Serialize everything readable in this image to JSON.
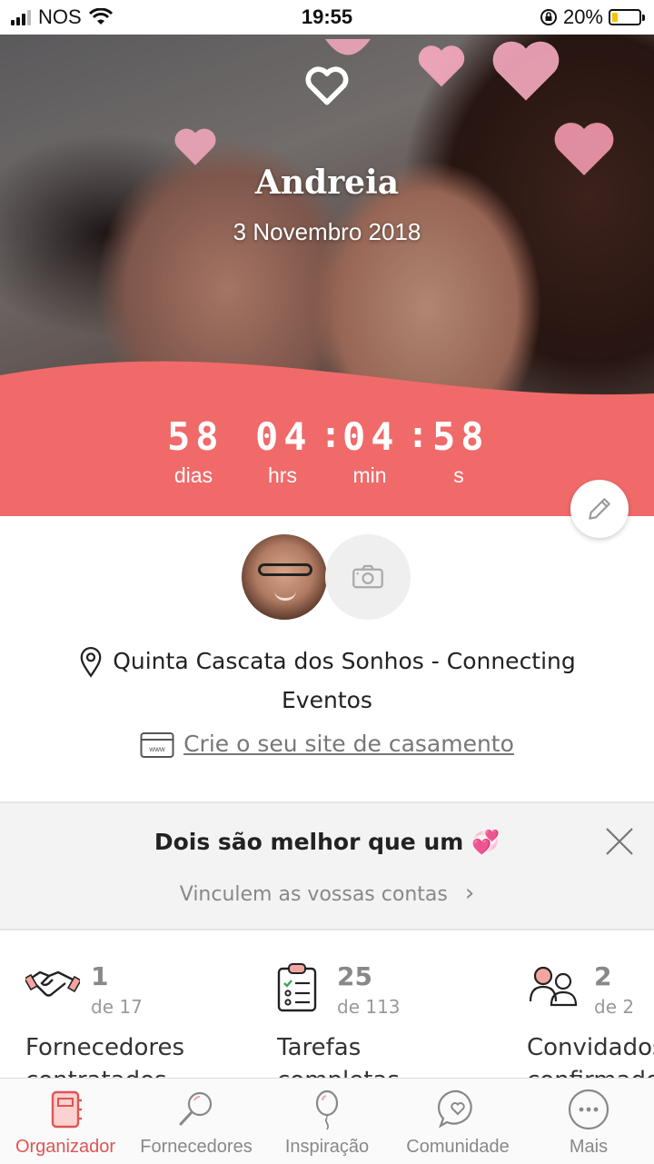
{
  "status_bar": {
    "carrier": "NOS",
    "time": "19:55",
    "battery_percent": "20%",
    "battery_level": 0.2,
    "icons": [
      "signal-icon",
      "wifi-icon",
      "orientation-lock-icon",
      "battery-icon"
    ]
  },
  "hero": {
    "couple_name": "Andreia",
    "wedding_date": "3 Novembro 2018",
    "accent_color": "#f06a6a",
    "icon": "heart-outline-icon"
  },
  "countdown": {
    "days": "58",
    "hours": "04",
    "minutes": "04",
    "seconds": "58",
    "separator": ":",
    "days_label": "dias",
    "hours_label": "hrs",
    "minutes_label": "min",
    "seconds_label": "s"
  },
  "profile": {
    "venue": "Quinta Cascata dos Sonhos - Connecting Eventos",
    "website_link": "Crie o seu site de casamento"
  },
  "banner": {
    "title": "Dois são melhor que um 💞",
    "subtitle": "Vinculem as vossas contas",
    "subtitle_chevron": "›"
  },
  "stats": [
    {
      "count": "1",
      "total": "de 17",
      "label": "Fornecedores",
      "label2": "contratados",
      "icon": "handshake-icon"
    },
    {
      "count": "25",
      "total": "de 113",
      "label": "Tarefas",
      "label2": "completas",
      "icon": "checklist-icon"
    },
    {
      "count": "2",
      "total": "de 2",
      "label": "Convidados",
      "label2": "confirmados",
      "icon": "guests-icon"
    }
  ],
  "tabbar": {
    "active_color": "#e05452",
    "tabs": [
      {
        "label": "Organizador",
        "icon": "planner-icon",
        "active": true
      },
      {
        "label": "Fornecedores",
        "icon": "search-icon",
        "active": false
      },
      {
        "label": "Inspiração",
        "icon": "balloon-icon",
        "active": false
      },
      {
        "label": "Comunidade",
        "icon": "chat-heart-icon",
        "active": false
      },
      {
        "label": "Mais",
        "icon": "more-icon",
        "active": false
      }
    ]
  }
}
